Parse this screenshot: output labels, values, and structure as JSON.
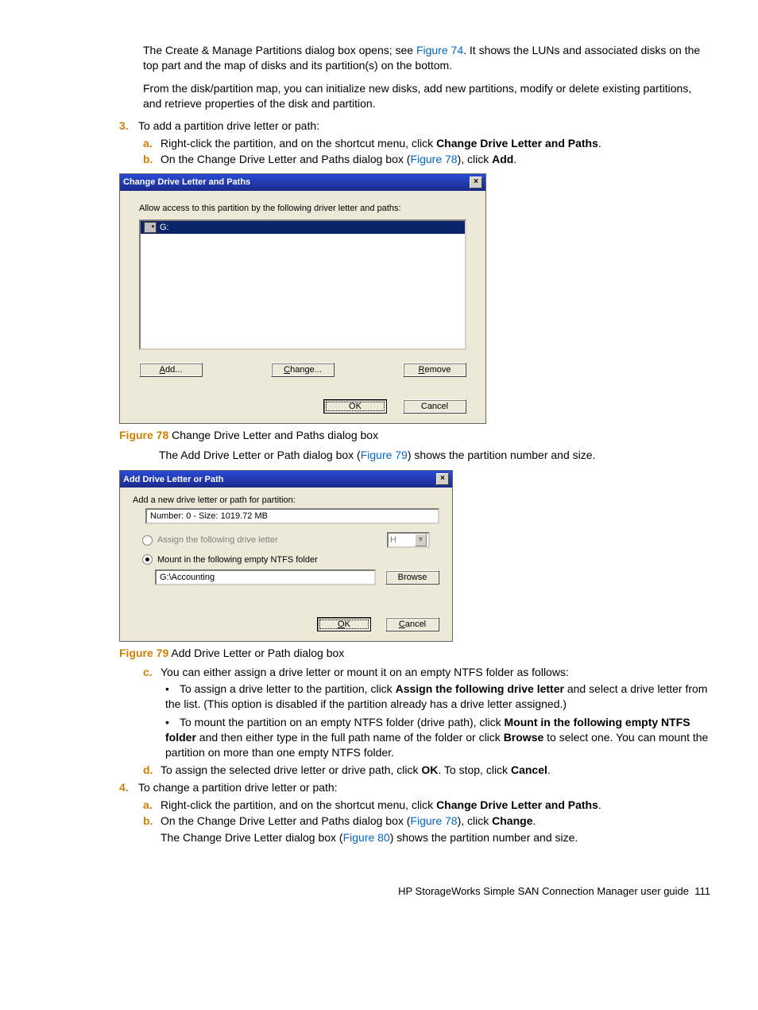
{
  "intro": {
    "p1a": "The Create & Manage Partitions dialog box opens; see ",
    "p1link": "Figure 74",
    "p1b": ". It shows the LUNs and associated disks on the top part and the map of disks and its partition(s) on the bottom.",
    "p2": "From the disk/partition map, you can initialize new disks, add new partitions, modify or delete existing partitions, and retrieve properties of the disk and partition."
  },
  "step3": {
    "marker": "3.",
    "text": "To add a partition drive letter or path:",
    "a": {
      "marker": "a.",
      "t1": "Right-click the partition, and on the shortcut menu, click ",
      "bold": "Change Drive Letter and Paths",
      "t2": "."
    },
    "b": {
      "marker": "b.",
      "t1": "On the Change Drive Letter and Paths dialog box (",
      "link": "Figure 78",
      "t2": "), click ",
      "bold": "Add",
      "t3": "."
    }
  },
  "dlg1": {
    "title": "Change Drive Letter and Paths",
    "instr": "Allow access to this partition by the following driver letter and paths:",
    "item": "G:",
    "add": "Add...",
    "change": "Change...",
    "remove": "Remove",
    "ok": "OK",
    "cancel": "Cancel"
  },
  "fig78": {
    "num": "Figure 78",
    "cap": " Change Drive Letter and Paths dialog box"
  },
  "mid": {
    "t1": "The Add Drive Letter or Path dialog box (",
    "link": "Figure 79",
    "t2": ") shows the partition number and size."
  },
  "dlg2": {
    "title": "Add Drive Letter or Path",
    "instr": "Add a new drive letter or path for partition:",
    "info": "Number: 0 - Size: 1019.72 MB",
    "opt1": "Assign the following drive letter",
    "sel": "H",
    "opt2": "Mount in the following empty NTFS folder",
    "path": "G:\\Accounting",
    "browse": "Browse",
    "ok": "OK",
    "cancel": "Cancel"
  },
  "fig79": {
    "num": "Figure 79",
    "cap": " Add Drive Letter or Path dialog box"
  },
  "step3c": {
    "marker": "c.",
    "text": "You can either assign a drive letter or mount it on an empty NTFS folder as follows:",
    "b1a": "To assign a drive letter to the partition, click ",
    "b1bold": "Assign the following drive letter",
    "b1b": " and select a drive letter from the list. (This option is disabled if the partition already has a drive letter assigned.)",
    "b2a": "To mount the partition on an empty NTFS folder (drive path), click ",
    "b2bold1": "Mount in the following empty NTFS folder",
    "b2b": " and then either type in the full path name of the folder or click ",
    "b2bold2": "Browse",
    "b2c": " to select one. You can mount the partition on more than one empty NTFS folder."
  },
  "step3d": {
    "marker": "d.",
    "t1": "To assign the selected drive letter or drive path, click ",
    "b1": "OK",
    "t2": ". To stop, click ",
    "b2": "Cancel",
    "t3": "."
  },
  "step4": {
    "marker": "4.",
    "text": "To change a partition drive letter or path:",
    "a": {
      "marker": "a.",
      "t1": "Right-click the partition, and on the shortcut menu, click ",
      "bold": "Change Drive Letter and Paths",
      "t2": "."
    },
    "b": {
      "marker": "b.",
      "t1": "On the Change Drive Letter and Paths dialog box (",
      "link": "Figure 78",
      "t2": "), click ",
      "bold": "Change",
      "t3": "."
    },
    "after": {
      "t1": "The Change Drive Letter dialog box (",
      "link": "Figure 80",
      "t2": ") shows the partition number and size."
    }
  },
  "footer": {
    "text": "HP StorageWorks Simple SAN Connection Manager user guide",
    "page": "111"
  }
}
